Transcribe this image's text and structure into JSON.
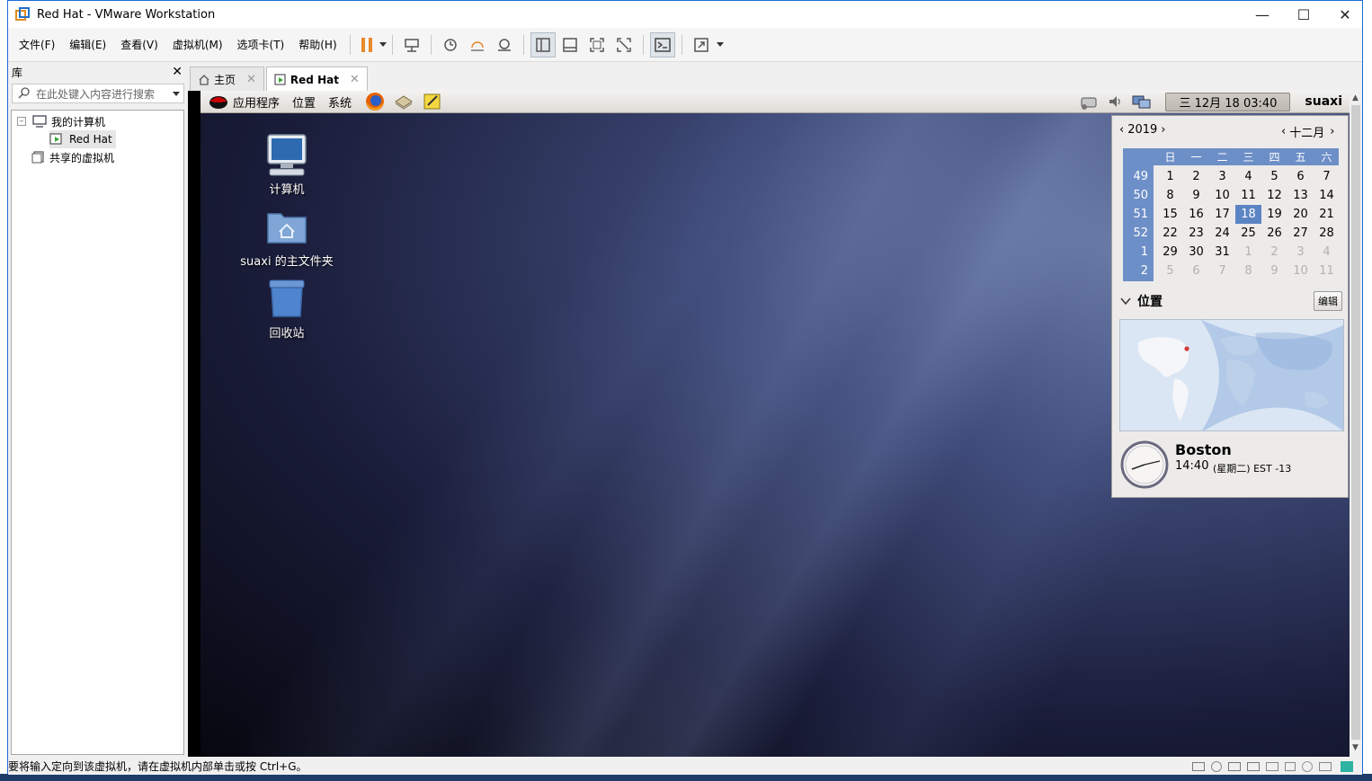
{
  "window": {
    "title": "Red Hat - VMware Workstation"
  },
  "menu": {
    "items": [
      "文件(F)",
      "编辑(E)",
      "查看(V)",
      "虚拟机(M)",
      "选项卡(T)",
      "帮助(H)"
    ]
  },
  "library": {
    "title": "库",
    "search_placeholder": "在此处键入内容进行搜索",
    "tree": {
      "my_computer": "我的计算机",
      "vm": "Red Hat",
      "shared": "共享的虚拟机"
    }
  },
  "tabs": [
    {
      "label": "主页",
      "active": false
    },
    {
      "label": "Red Hat",
      "active": true
    }
  ],
  "guest": {
    "panel": {
      "applications": "应用程序",
      "places": "位置",
      "system": "系统",
      "clock": "三 12月 18 03:40",
      "user": "suaxi"
    },
    "desktop_icons": [
      {
        "label": "计算机",
        "icon": "computer-icon"
      },
      {
        "label": "suaxi 的主文件夹",
        "icon": "home-folder-icon"
      },
      {
        "label": "回收站",
        "icon": "trash-icon"
      }
    ],
    "calendar": {
      "year": "2019",
      "month": "十二月",
      "weekdays": [
        "日",
        "一",
        "二",
        "三",
        "四",
        "五",
        "六"
      ],
      "weeks": [
        {
          "num": "49",
          "days": [
            "1",
            "2",
            "3",
            "4",
            "5",
            "6",
            "7"
          ]
        },
        {
          "num": "50",
          "days": [
            "8",
            "9",
            "10",
            "11",
            "12",
            "13",
            "14"
          ]
        },
        {
          "num": "51",
          "days": [
            "15",
            "16",
            "17",
            "18",
            "19",
            "20",
            "21"
          ]
        },
        {
          "num": "52",
          "days": [
            "22",
            "23",
            "24",
            "25",
            "26",
            "27",
            "28"
          ]
        },
        {
          "num": "1",
          "days": [
            "29",
            "30",
            "31",
            "1",
            "2",
            "3",
            "4"
          ]
        },
        {
          "num": "2",
          "days": [
            "5",
            "6",
            "7",
            "8",
            "9",
            "10",
            "11"
          ]
        }
      ],
      "today": "18",
      "locations_label": "位置",
      "edit_label": "编辑",
      "city": "Boston",
      "city_time": "14:40",
      "city_detail": "(星期二) EST -13"
    }
  },
  "status": {
    "message": "要将输入定向到该虚拟机，请在虚拟机内部单击或按 Ctrl+G。"
  },
  "colors": {
    "accent": "#1e6bd6",
    "calendar_header": "#6d8fc7",
    "today_bg": "#5b84c4",
    "pause": "#e8892b"
  }
}
